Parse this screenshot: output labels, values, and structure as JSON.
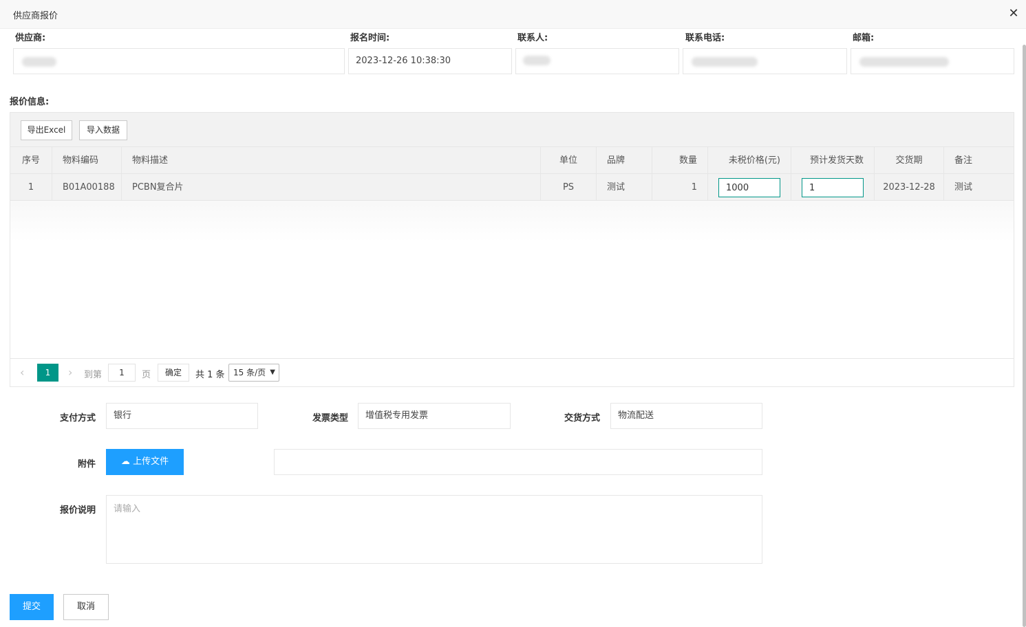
{
  "dialog": {
    "title": "供应商报价",
    "close_icon": "close-icon"
  },
  "header_fields": {
    "supplier_label": "供应商:",
    "signup_time_label": "报名时间:",
    "signup_time_value": "2023-12-26 10:38:30",
    "contact_label": "联系人:",
    "phone_label": "联系电话:",
    "email_label": "邮箱:"
  },
  "quote_section": {
    "title": "报价信息:"
  },
  "toolbar": {
    "export_label": "导出Excel",
    "import_label": "导入数据"
  },
  "table": {
    "headers": [
      "序号",
      "物料编码",
      "物料描述",
      "单位",
      "品牌",
      "数量",
      "未税价格(元)",
      "预计发货天数",
      "交货期",
      "备注"
    ],
    "rows": [
      {
        "index": "1",
        "code": "B01A00188",
        "desc": "PCBN复合片",
        "unit": "PS",
        "brand": "测试",
        "qty": "1",
        "price": "1000",
        "days": "1",
        "delivery": "2023-12-28",
        "remark": "测试"
      }
    ]
  },
  "pager": {
    "current": "1",
    "goto_label": "到第",
    "goto_value": "1",
    "page_suffix": "页",
    "confirm": "确定",
    "total": "共 1 条",
    "page_size": "15 条/页"
  },
  "form": {
    "payment_label": "支付方式",
    "payment_value": "银行",
    "invoice_label": "发票类型",
    "invoice_value": "增值税专用发票",
    "delivery_label": "交货方式",
    "delivery_value": "物流配送",
    "attachment_label": "附件",
    "upload_label": "上传文件",
    "note_label": "报价说明",
    "note_placeholder": "请输入"
  },
  "actions": {
    "submit": "提交",
    "cancel": "取消"
  }
}
